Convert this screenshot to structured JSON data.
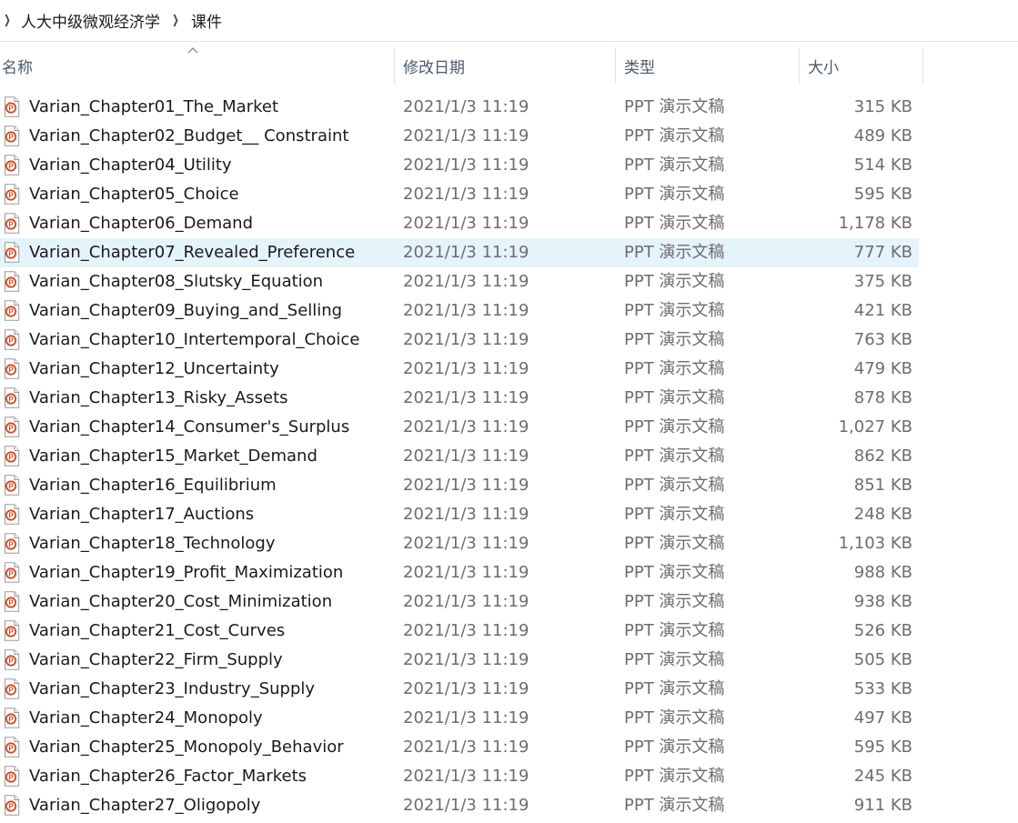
{
  "breadcrumb": {
    "items": [
      "人大中级微观经济学",
      "课件"
    ]
  },
  "columns": {
    "name": "名称",
    "date": "修改日期",
    "type": "类型",
    "size": "大小"
  },
  "icons": {
    "file": "ppt-file-icon",
    "chevron": "chevron-right-icon",
    "sort": "sort-ascending-icon"
  },
  "colors": {
    "selection": "#e5f3fb",
    "ppt_accent": "#d04a23"
  },
  "files": [
    {
      "name": "Varian_Chapter01_The_Market",
      "date": "2021/1/3 11:19",
      "type": "PPT 演示文稿",
      "size": "315 KB"
    },
    {
      "name": "Varian_Chapter02_Budget__ Constraint",
      "date": "2021/1/3 11:19",
      "type": "PPT 演示文稿",
      "size": "489 KB"
    },
    {
      "name": "Varian_Chapter04_Utility",
      "date": "2021/1/3 11:19",
      "type": "PPT 演示文稿",
      "size": "514 KB"
    },
    {
      "name": "Varian_Chapter05_Choice",
      "date": "2021/1/3 11:19",
      "type": "PPT 演示文稿",
      "size": "595 KB"
    },
    {
      "name": "Varian_Chapter06_Demand",
      "date": "2021/1/3 11:19",
      "type": "PPT 演示文稿",
      "size": "1,178 KB"
    },
    {
      "name": "Varian_Chapter07_Revealed_Preference",
      "date": "2021/1/3 11:19",
      "type": "PPT 演示文稿",
      "size": "777 KB",
      "selected": true
    },
    {
      "name": "Varian_Chapter08_Slutsky_Equation",
      "date": "2021/1/3 11:19",
      "type": "PPT 演示文稿",
      "size": "375 KB"
    },
    {
      "name": "Varian_Chapter09_Buying_and_Selling",
      "date": "2021/1/3 11:19",
      "type": "PPT 演示文稿",
      "size": "421 KB"
    },
    {
      "name": "Varian_Chapter10_Intertemporal_Choice",
      "date": "2021/1/3 11:19",
      "type": "PPT 演示文稿",
      "size": "763 KB"
    },
    {
      "name": "Varian_Chapter12_Uncertainty",
      "date": "2021/1/3 11:19",
      "type": "PPT 演示文稿",
      "size": "479 KB"
    },
    {
      "name": "Varian_Chapter13_Risky_Assets",
      "date": "2021/1/3 11:19",
      "type": "PPT 演示文稿",
      "size": "878 KB"
    },
    {
      "name": "Varian_Chapter14_Consumer's_Surplus",
      "date": "2021/1/3 11:19",
      "type": "PPT 演示文稿",
      "size": "1,027 KB"
    },
    {
      "name": "Varian_Chapter15_Market_Demand",
      "date": "2021/1/3 11:19",
      "type": "PPT 演示文稿",
      "size": "862 KB"
    },
    {
      "name": "Varian_Chapter16_Equilibrium",
      "date": "2021/1/3 11:19",
      "type": "PPT 演示文稿",
      "size": "851 KB"
    },
    {
      "name": "Varian_Chapter17_Auctions",
      "date": "2021/1/3 11:19",
      "type": "PPT 演示文稿",
      "size": "248 KB"
    },
    {
      "name": "Varian_Chapter18_Technology",
      "date": "2021/1/3 11:19",
      "type": "PPT 演示文稿",
      "size": "1,103 KB"
    },
    {
      "name": "Varian_Chapter19_Profit_Maximization",
      "date": "2021/1/3 11:19",
      "type": "PPT 演示文稿",
      "size": "988 KB"
    },
    {
      "name": "Varian_Chapter20_Cost_Minimization",
      "date": "2021/1/3 11:19",
      "type": "PPT 演示文稿",
      "size": "938 KB"
    },
    {
      "name": "Varian_Chapter21_Cost_Curves",
      "date": "2021/1/3 11:19",
      "type": "PPT 演示文稿",
      "size": "526 KB"
    },
    {
      "name": "Varian_Chapter22_Firm_Supply",
      "date": "2021/1/3 11:19",
      "type": "PPT 演示文稿",
      "size": "505 KB"
    },
    {
      "name": "Varian_Chapter23_Industry_Supply",
      "date": "2021/1/3 11:19",
      "type": "PPT 演示文稿",
      "size": "533 KB"
    },
    {
      "name": "Varian_Chapter24_Monopoly",
      "date": "2021/1/3 11:19",
      "type": "PPT 演示文稿",
      "size": "497 KB"
    },
    {
      "name": "Varian_Chapter25_Monopoly_Behavior",
      "date": "2021/1/3 11:19",
      "type": "PPT 演示文稿",
      "size": "595 KB"
    },
    {
      "name": "Varian_Chapter26_Factor_Markets",
      "date": "2021/1/3 11:19",
      "type": "PPT 演示文稿",
      "size": "245 KB"
    },
    {
      "name": "Varian_Chapter27_Oligopoly",
      "date": "2021/1/3 11:19",
      "type": "PPT 演示文稿",
      "size": "911 KB"
    }
  ]
}
